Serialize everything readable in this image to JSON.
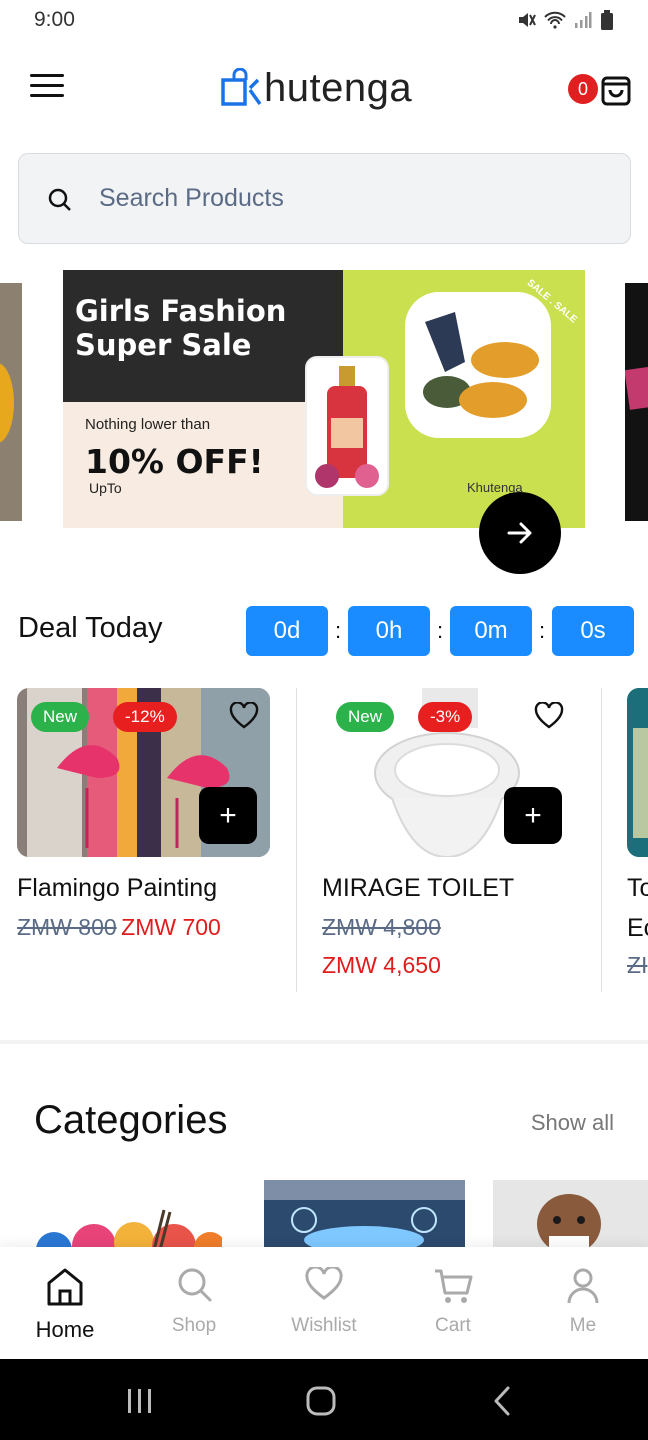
{
  "status_bar": {
    "time": "9:00"
  },
  "header": {
    "logo_text": "hutenga",
    "cart_count": "0"
  },
  "search": {
    "placeholder": "Search Products"
  },
  "banner": {
    "title_line1": "Girls Fashion",
    "title_line2": "Super Sale",
    "subtitle": "Nothing lower than",
    "discount": "10% OFF!",
    "upto": "UpTo",
    "brand": "Khutenga",
    "sale_ring": "SALE . SALE"
  },
  "deal": {
    "title": "Deal Today",
    "timer": {
      "days": "0d",
      "hours": "0h",
      "minutes": "0m",
      "seconds": "0s"
    }
  },
  "products": [
    {
      "name": "Flamingo Painting",
      "badge_new": "New",
      "badge_off": "-12%",
      "old_price": "ZMW 800",
      "new_price": "ZMW 700"
    },
    {
      "name": "MIRAGE TOILET",
      "badge_new": "New",
      "badge_off": "-3%",
      "old_price": "ZMW 4,800",
      "new_price": "ZMW 4,650"
    },
    {
      "name": "To",
      "name_line2": "Ec",
      "old_price": "ZI"
    }
  ],
  "categories": {
    "title": "Categories",
    "show_all": "Show all"
  },
  "bottom_nav": [
    {
      "label": "Home",
      "icon": "home-icon",
      "active": true
    },
    {
      "label": "Shop",
      "icon": "search-icon"
    },
    {
      "label": "Wishlist",
      "icon": "heart-icon"
    },
    {
      "label": "Cart",
      "icon": "cart-icon"
    },
    {
      "label": "Me",
      "icon": "user-icon"
    }
  ],
  "colors": {
    "accent_blue": "#1a8cff",
    "sale_red": "#e01c1c",
    "new_green": "#2bb24a",
    "banner_green": "#cbe04f"
  }
}
